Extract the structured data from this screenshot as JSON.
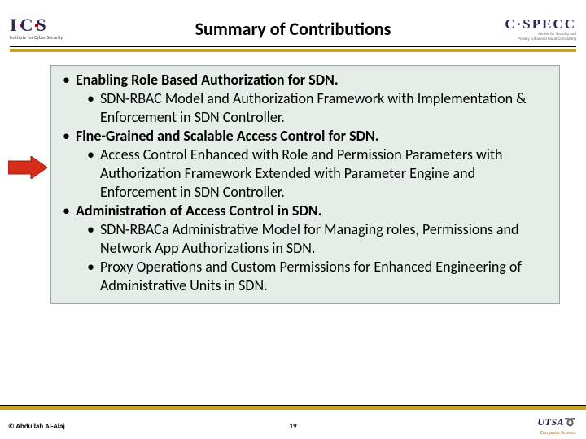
{
  "header": {
    "title": "Summary of Contributions",
    "logo_left": {
      "text": "I C S",
      "sub": "Institute for Cyber Security"
    },
    "logo_right": {
      "text": "C·SPECC",
      "sub1": "Center for Security and",
      "sub2": "Privacy Enhanced Cloud Computing"
    }
  },
  "bullets": {
    "b1": "Enabling Role Based Authorization for SDN.",
    "b1a": "SDN-RBAC Model and Authorization Framework with Implementation & Enforcement in SDN Controller.",
    "b2": "Fine-Grained and Scalable Access Control for SDN.",
    "b2a": "Access Control Enhanced with Role and Permission Parameters with Authorization Framework Extended with Parameter Engine and Enforcement in SDN Controller.",
    "b3": "Administration of Access Control in SDN.",
    "b3a": "SDN-RBACa Administrative Model for Managing roles, Permissions and Network App Authorizations in SDN.",
    "b3b": "Proxy Operations and Custom Permissions for Enhanced Engineering of Administrative Units in SDN."
  },
  "footer": {
    "copyright": "© Abdullah Al-Alaj",
    "page": "19",
    "utsa": "UTSA",
    "utsa_sub": "Computer Science"
  }
}
